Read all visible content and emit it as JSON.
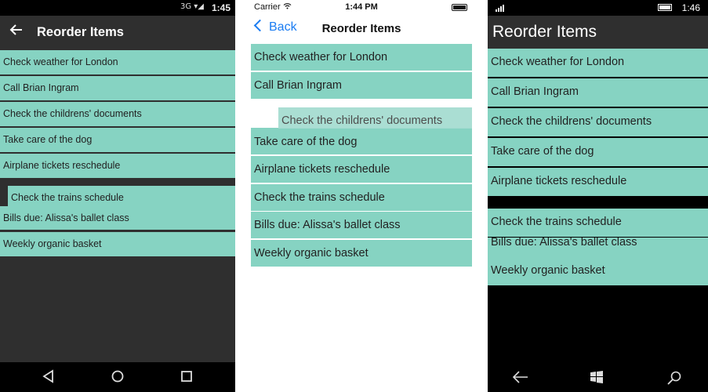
{
  "android": {
    "status_icons": "3G ▾◢",
    "time": "1:45",
    "title": "Reorder Items",
    "items": [
      "Check weather for London",
      "Call Brian Ingram",
      "Check the childrens' documents",
      "Take care of the dog",
      "Airplane tickets reschedule",
      "Check the trains schedule",
      "Bills due: Alissa's ballet class",
      "Weekly organic basket"
    ],
    "dragging_item": "Check the trains schedule"
  },
  "ios": {
    "carrier": "Carrier",
    "time": "1:44 PM",
    "back_label": "Back",
    "title": "Reorder Items",
    "items": [
      "Check weather for London",
      "Call Brian Ingram",
      "Check the childrens' documents",
      "Take care of the dog",
      "Airplane tickets reschedule",
      "Check the trains schedule",
      "Bills due: Alissa's ballet class",
      "Weekly organic basket"
    ],
    "dragging_item": "Check the childrens' documents"
  },
  "windows": {
    "time": "1:46",
    "title": "Reorder Items",
    "items": [
      "Check weather for London",
      "Call Brian Ingram",
      "Check the childrens' documents",
      "Take care of the dog",
      "Airplane tickets reschedule",
      "Check the trains schedule",
      "Bills due: Alissa's ballet class",
      "Weekly organic basket"
    ],
    "dragging_item": "Check the trains schedule"
  },
  "colors": {
    "row": "#86d3c2",
    "ios_accent": "#1a7cf2",
    "dark": "#2f2f2f"
  }
}
